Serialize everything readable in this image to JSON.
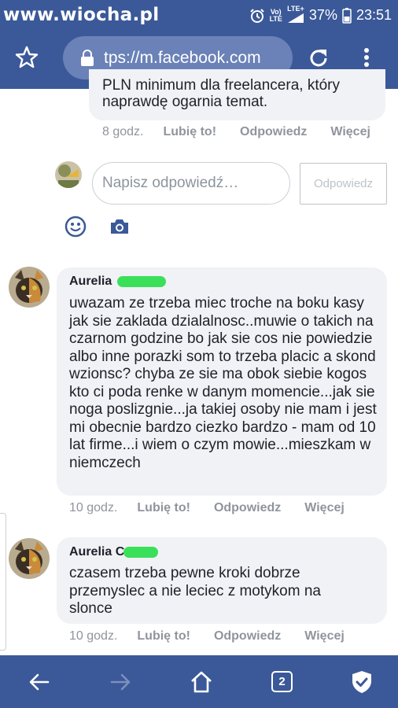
{
  "status_bar": {
    "watermark": "www.wiocha.pl",
    "network_top": "Vo)",
    "network_bottom": "LTE",
    "lte_top": "LTE+",
    "lte_bottom": "",
    "battery": "37%",
    "time": "23:51"
  },
  "browser": {
    "url": "tps://m.facebook.com"
  },
  "top_comment": {
    "partial_line": "PLN minimum dla freelancera, który",
    "last_line": "naprawdę ogarnia temat.",
    "time": "8 godz.",
    "like": "Lubię to!",
    "reply": "Odpowiedz",
    "more": "Więcej"
  },
  "reply_box": {
    "placeholder": "Napisz odpowiedź…",
    "button": "Odpowiedz"
  },
  "comments": [
    {
      "author": "Aurelia",
      "text": "uwazam ze trzeba miec troche na boku kasy jak sie zaklada dzialalnosc..muwie o takich na czarnom godzine bo jak sie cos nie powiedzie albo inne porazki som to trzeba placic a skond wzionsc? chyba ze sie ma obok siebie kogos kto ci poda renke w danym momencie...jak sie noga poslizgnie...ja takiej osoby nie mam i jest mi obecnie bardzo ciezko bardzo - mam od 10 lat firme...i wiem o czym mowie...mieszkam w niemczech",
      "time": "10 godz.",
      "like": "Lubię to!",
      "reply": "Odpowiedz",
      "more": "Więcej"
    },
    {
      "author": "Aurelia C",
      "text": "czasem trzeba pewne kroki dobrze przemyslec a nie leciec z motykom na slonce",
      "time": "10 godz.",
      "like": "Lubię to!",
      "reply": "Odpowiedz",
      "more": "Więcej"
    }
  ],
  "nav": {
    "tabs_count": "2"
  },
  "colors": {
    "facebook_blue": "#3b5998",
    "bubble": "#f1f2f6",
    "meta_gray": "#90949c",
    "redaction_green": "#3be05a"
  }
}
